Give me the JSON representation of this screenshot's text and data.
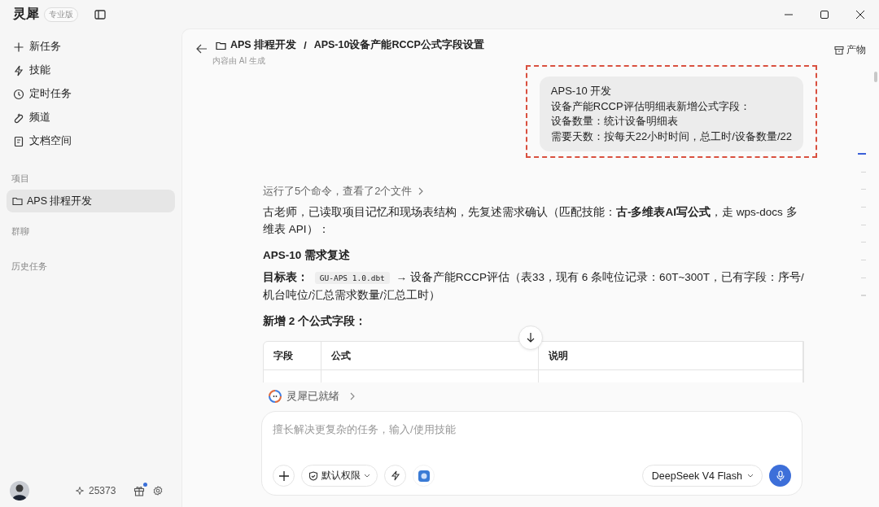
{
  "app": {
    "name": "灵犀",
    "edition": "专业版"
  },
  "sidebar": {
    "nav": [
      {
        "label": "新任务"
      },
      {
        "label": "技能"
      },
      {
        "label": "定时任务"
      },
      {
        "label": "频道"
      },
      {
        "label": "文档空间"
      }
    ],
    "projects_label": "项目",
    "projects": [
      {
        "label": "APS 排程开发",
        "selected": true
      }
    ],
    "groups_label": "群聊",
    "history_label": "历史任务",
    "points": "25373",
    "gift_notification": true
  },
  "header": {
    "project": "APS 排程开发",
    "separator": "/",
    "title": "APS-10设备产能RCCP公式字段设置",
    "subtitle": "内容由 AI 生成",
    "artifacts": "产物"
  },
  "user_message": {
    "highlighted": true,
    "lines": [
      "APS-10 开发",
      "设备产能RCCP评估明细表新增公式字段：",
      "设备数量：统计设备明细表",
      "需要天数：按每天22小时时间，总工时/设备数量/22"
    ]
  },
  "assistant_blocks": [
    {
      "kind": "tool_summary",
      "text": "运行了5个命令，查看了2个文件"
    },
    {
      "kind": "paragraph",
      "text": "古老师，已读取项目记忆和现场表结构，先复述需求确认（匹配技能：**古-多维表AI写公式**，走 wps-docs 多维表 API）："
    },
    {
      "kind": "heading",
      "text": "APS-10 需求复述"
    },
    {
      "kind": "target",
      "label": "目标表：",
      "code": "GU-APS 1.0.dbt",
      "text": "→ 设备产能RCCP评估（表33，现有 6 条吨位记录：60T~300T，已有字段：序号/机台吨位/汇总需求数量/汇总工时）"
    },
    {
      "kind": "heading",
      "text": "新增 2 个公式字段："
    },
    {
      "kind": "table",
      "columns": [
        "字段",
        "公式",
        "说明"
      ]
    }
  ],
  "outline_marks": [
    {
      "selected": true
    },
    {
      "selected": false
    },
    {
      "selected": false
    },
    {
      "selected": false
    },
    {
      "selected": false
    },
    {
      "selected": false
    },
    {
      "selected": false
    },
    {
      "selected": false
    },
    {
      "selected": false
    }
  ],
  "composer": {
    "status": "灵犀已就绪",
    "placeholder": "擅长解决更复杂的任务，输入/使用技能",
    "permission": "默认权限",
    "model": "DeepSeek V4 Flash"
  }
}
